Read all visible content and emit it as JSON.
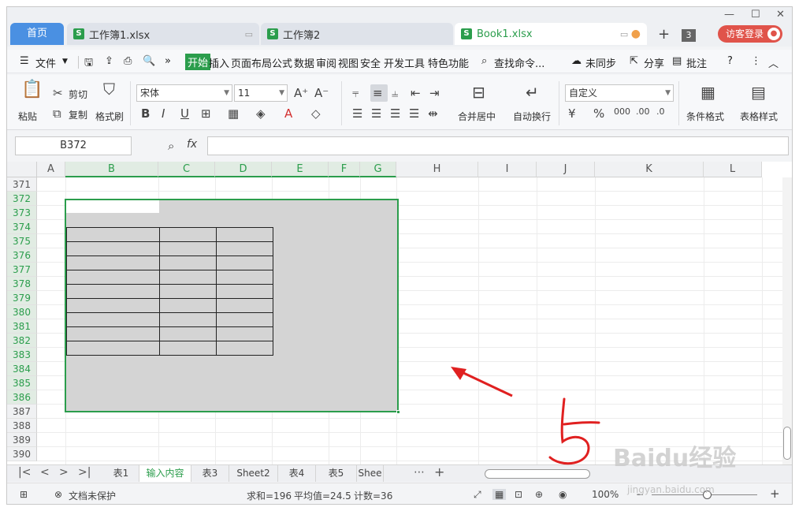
{
  "tabs": {
    "home": "首页",
    "docs": [
      {
        "label": "工作簿1.xlsx"
      },
      {
        "label": "工作簿2"
      },
      {
        "label": "Book1.xlsx"
      }
    ],
    "count": "3",
    "login": "访客登录"
  },
  "menu": {
    "file": "文件",
    "items": [
      "开始",
      "插入",
      "页面布局",
      "公式",
      "数据",
      "审阅",
      "视图",
      "安全",
      "开发工具",
      "特色功能"
    ],
    "search": "查找命令...",
    "sync": "未同步",
    "share": "分享",
    "comment": "批注"
  },
  "ribbon": {
    "paste": "粘贴",
    "cut": "剪切",
    "copy": "复制",
    "format_painter": "格式刷",
    "font_name": "宋体",
    "font_size": "11",
    "merge": "合并居中",
    "wrap": "自动换行",
    "number_format": "自定义",
    "cond_format": "条件格式",
    "table_style": "表格样式"
  },
  "formula": {
    "cell_ref": "B372",
    "fx": "fx",
    "content": ""
  },
  "columns": [
    "A",
    "B",
    "C",
    "D",
    "E",
    "F",
    "G",
    "H",
    "I",
    "J",
    "K",
    "L"
  ],
  "rows": [
    "371",
    "372",
    "373",
    "374",
    "375",
    "376",
    "377",
    "378",
    "379",
    "380",
    "381",
    "382",
    "383",
    "384",
    "385",
    "386",
    "387",
    "388",
    "389",
    "390"
  ],
  "sheets": [
    "表1",
    "输入内容",
    "表3",
    "Sheet2",
    "表4",
    "表5",
    "Shee"
  ],
  "status": {
    "protect": "文档未保护",
    "sum": "求和=196",
    "avg": "平均值=24.5",
    "count": "计数=36",
    "zoom": "100%"
  },
  "annotation": {
    "step": "5",
    "watermark": "Baidu经验",
    "watermark_url": "jingyan.baidu.com"
  },
  "colors": {
    "accent": "#2b9d4c",
    "home_tab": "#4a90e2",
    "login": "#e0534a",
    "annotation": "#e02020"
  }
}
